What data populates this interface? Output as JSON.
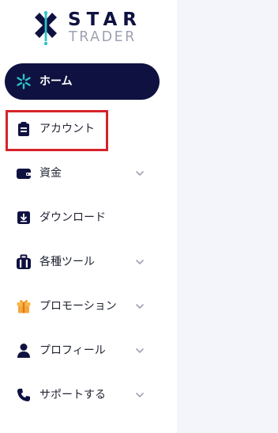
{
  "brand": {
    "line1": "STAR",
    "line2": "TRADER",
    "primary_color": "#0f1240",
    "accent_color": "#2ec4c8",
    "muted_color": "#9ea2b1"
  },
  "sidebar": {
    "items": [
      {
        "label": "ホーム",
        "icon": "home-star-icon",
        "active": true,
        "expandable": false
      },
      {
        "label": "アカウント",
        "icon": "clipboard-icon",
        "active": false,
        "expandable": false,
        "highlighted": true
      },
      {
        "label": "資金",
        "icon": "wallet-icon",
        "active": false,
        "expandable": true
      },
      {
        "label": "ダウンロード",
        "icon": "download-icon",
        "active": false,
        "expandable": false
      },
      {
        "label": "各種ツール",
        "icon": "toolbox-icon",
        "active": false,
        "expandable": true
      },
      {
        "label": "プロモーション",
        "icon": "gift-icon",
        "active": false,
        "expandable": true
      },
      {
        "label": "プロフィール",
        "icon": "user-icon",
        "active": false,
        "expandable": true
      },
      {
        "label": "サポートする",
        "icon": "phone-icon",
        "active": false,
        "expandable": true
      }
    ]
  },
  "colors": {
    "active_bg": "#0f1240",
    "highlight_border": "#d6232b",
    "content_bg": "#f4f5fa"
  }
}
